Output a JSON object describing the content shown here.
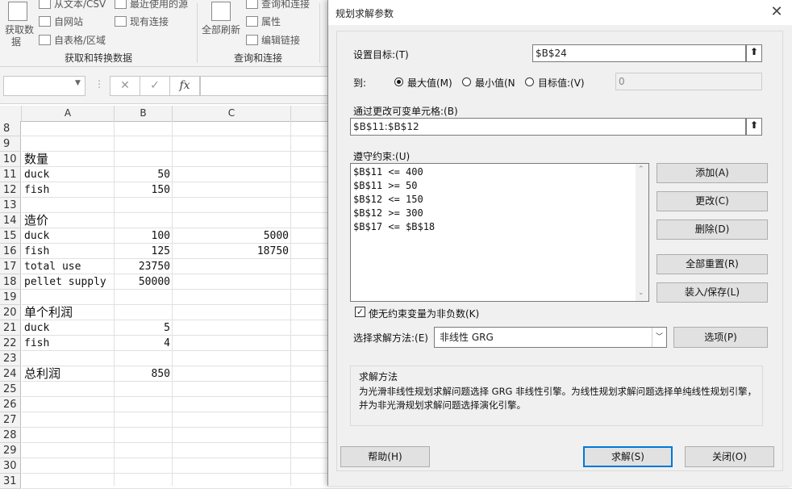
{
  "ribbon": {
    "get_data_label": "获取数",
    "get_data_label2": "据",
    "from_text": "从文本/CSV",
    "from_web": "自网站",
    "from_table": "自表格/区域",
    "recent_sources": "最近使用的源",
    "existing_conn": "现有连接",
    "group1": "获取和转换数据",
    "refresh_all": "全部刷新",
    "queries_conn": "查询和连接",
    "properties": "属性",
    "edit_links": "编辑链接",
    "group2": "查询和连接"
  },
  "formula_bar": {
    "fx": "fx",
    "cancel": "✕",
    "enter": "✓"
  },
  "sheet": {
    "columns": [
      "A",
      "B",
      "C"
    ],
    "rows": [
      {
        "n": "8",
        "a": "",
        "b": "",
        "c": ""
      },
      {
        "n": "9",
        "a": "",
        "b": "",
        "c": ""
      },
      {
        "n": "10",
        "a": "数量",
        "b": "",
        "c": ""
      },
      {
        "n": "11",
        "a": "duck",
        "b": "50",
        "c": ""
      },
      {
        "n": "12",
        "a": "fish",
        "b": "150",
        "c": ""
      },
      {
        "n": "13",
        "a": "",
        "b": "",
        "c": ""
      },
      {
        "n": "14",
        "a": "造价",
        "b": "",
        "c": ""
      },
      {
        "n": "15",
        "a": "duck",
        "b": "100",
        "c": "5000"
      },
      {
        "n": "16",
        "a": "fish",
        "b": "125",
        "c": "18750"
      },
      {
        "n": "17",
        "a": "total use",
        "b": "23750",
        "c": ""
      },
      {
        "n": "18",
        "a": "pellet supply",
        "b": "50000",
        "c": ""
      },
      {
        "n": "19",
        "a": "",
        "b": "",
        "c": ""
      },
      {
        "n": "20",
        "a": "单个利润",
        "b": "",
        "c": ""
      },
      {
        "n": "21",
        "a": "duck",
        "b": "5",
        "c": ""
      },
      {
        "n": "22",
        "a": "fish",
        "b": "4",
        "c": ""
      },
      {
        "n": "23",
        "a": "",
        "b": "",
        "c": ""
      },
      {
        "n": "24",
        "a": "总利润",
        "b": "850",
        "c": ""
      },
      {
        "n": "25",
        "a": "",
        "b": "",
        "c": ""
      },
      {
        "n": "26",
        "a": "",
        "b": "",
        "c": ""
      },
      {
        "n": "27",
        "a": "",
        "b": "",
        "c": ""
      },
      {
        "n": "28",
        "a": "",
        "b": "",
        "c": ""
      },
      {
        "n": "29",
        "a": "",
        "b": "",
        "c": ""
      },
      {
        "n": "30",
        "a": "",
        "b": "",
        "c": ""
      },
      {
        "n": "31",
        "a": "",
        "b": "",
        "c": ""
      }
    ]
  },
  "dialog": {
    "title": "规划求解参数",
    "close": "✕",
    "set_objective_label": "设置目标:(T)",
    "objective_value": "$B$24",
    "to_label": "到:",
    "max_label": "最大值(M)",
    "min_label": "最小值(N",
    "value_of_label": "目标值:(V)",
    "value_of_value": "0",
    "by_changing_label": "通过更改可变单元格:(B)",
    "changing_value": "$B$11:$B$12",
    "subject_to_label": "遵守约束:(U)",
    "constraints": [
      "$B$11 <= 400",
      "$B$11 >= 50",
      "$B$12 <= 150",
      "$B$12 >= 300",
      "$B$17 <= $B$18"
    ],
    "add_btn": "添加(A)",
    "change_btn": "更改(C)",
    "delete_btn": "删除(D)",
    "reset_btn": "全部重置(R)",
    "load_save_btn": "装入/保存(L)",
    "nonneg_label": "使无约束变量为非负数(K)",
    "method_label": "选择求解方法:(E)",
    "method_value": "非线性 GRG",
    "options_btn": "选项(P)",
    "desc_title": "求解方法",
    "desc_text": "为光滑非线性规划求解问题选择 GRG 非线性引擎。为线性规划求解问题选择单纯线性规划引擎，并为非光滑规划求解问题选择演化引擎。",
    "help_btn": "帮助(H)",
    "solve_btn": "求解(S)",
    "close_btn": "关闭(O)"
  }
}
